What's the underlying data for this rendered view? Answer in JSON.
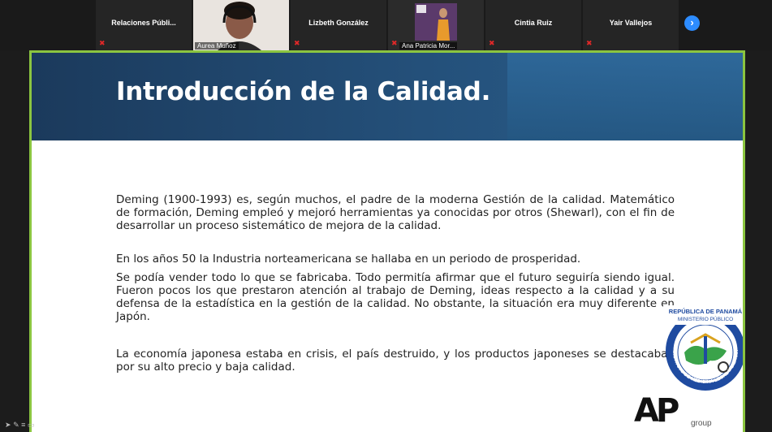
{
  "participants": [
    {
      "name": "Relaciones  Públi...",
      "muted": true
    },
    {
      "name": "Aurea Muñoz",
      "video": true
    },
    {
      "name": "Lizbeth González",
      "muted": true
    },
    {
      "name": "Ana Patricia Mor...",
      "video": true,
      "muted": true
    },
    {
      "name": "Cintia Ruiz",
      "muted": true
    },
    {
      "name": "Yair Vallejos",
      "muted": true
    }
  ],
  "next_glyph": "›",
  "slide": {
    "title": "Introducción de la Calidad.",
    "paragraphs": [
      "Deming (1900-1993) es, según muchos, el padre de la moderna Gestión de la calidad. Matemático de formación, Deming empleó y mejoró herramientas ya conocidas por otros (Shewarl), con el fin de desarrollar un proceso sistemático de mejora de la calidad.",
      "En los años 50 la Industria norteamericana se hallaba en un periodo de prosperidad.",
      "Se podía vender todo lo que se fabricaba. Todo permitía afirmar que el futuro seguiría siendo igual. Fueron pocos los que prestaron atención al trabajo de Deming, ideas respecto a la calidad y a su defensa de la estadística en la gestión de la calidad. No obstante, la situación era muy diferente en Japón.",
      "La economía japonesa estaba en crisis, el país destruido, y los productos japoneses se destacaban por su alto precio y baja calidad."
    ]
  },
  "seal": {
    "line1": "REPÚBLICA DE PANAMÁ",
    "line2": "MINISTERIO PÚBLICO",
    "ring_text": "INSTITUTO DE MEDICINA LEGAL Y CIENCIAS FORENSES"
  },
  "brand": {
    "logo": "AP",
    "sub": "group"
  },
  "colors": {
    "frame": "#8bc540",
    "header": "#1b3a5c",
    "accent": "#2d8cff"
  }
}
